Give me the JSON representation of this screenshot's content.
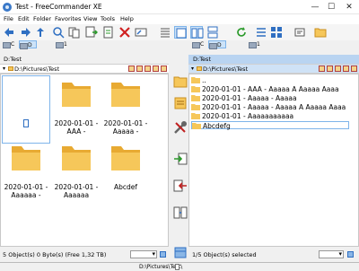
{
  "window": {
    "title": "Test - FreeCommander XE",
    "minimize": "—",
    "maximize": "☐",
    "close": "✕"
  },
  "menu": [
    "File",
    "Edit",
    "Folder",
    "Favorites",
    "View",
    "Tools",
    "Help"
  ],
  "drives": {
    "c": "C",
    "d": "D",
    "one": "1"
  },
  "left": {
    "tab": "D:Test",
    "path": "D:\\Pictures\\Test",
    "items": [
      {
        "name": ""
      },
      {
        "name": "2020-01-01 - AAA -"
      },
      {
        "name": "2020-01-01 - Aaaaa -"
      },
      {
        "name": "2020-01-01 - Aaaaaa -"
      },
      {
        "name": "2020-01-01 - Aaaaaa"
      },
      {
        "name": "Abcdef"
      }
    ],
    "status": "5 Object(s)  0 Byte(s)   (Free 1,32 TB)"
  },
  "right": {
    "tab": "D:Test",
    "path": "D:\\Pictures\\Test",
    "items": [
      {
        "name": ".."
      },
      {
        "name": "2020-01-01 - AAA - Aaaaa A Aaaaa Aaaa"
      },
      {
        "name": "2020-01-01 - Aaaaa - Aaaaa"
      },
      {
        "name": "2020-01-01 - Aaaaa - Aaaaa A Aaaaa Aaaa"
      },
      {
        "name": "2020-01-01 - Aaaaaaaaaaa"
      },
      {
        "name": "Abcdefg"
      }
    ],
    "status": "1/5 Object(s) selected"
  },
  "footer_path": "D:\\Pictures\\Test\\",
  "colors": {
    "accent": "#7eb4ea",
    "folder": "#f6c75a",
    "folder_dark": "#e8aa32",
    "tab_active": "#b9d4f1"
  }
}
